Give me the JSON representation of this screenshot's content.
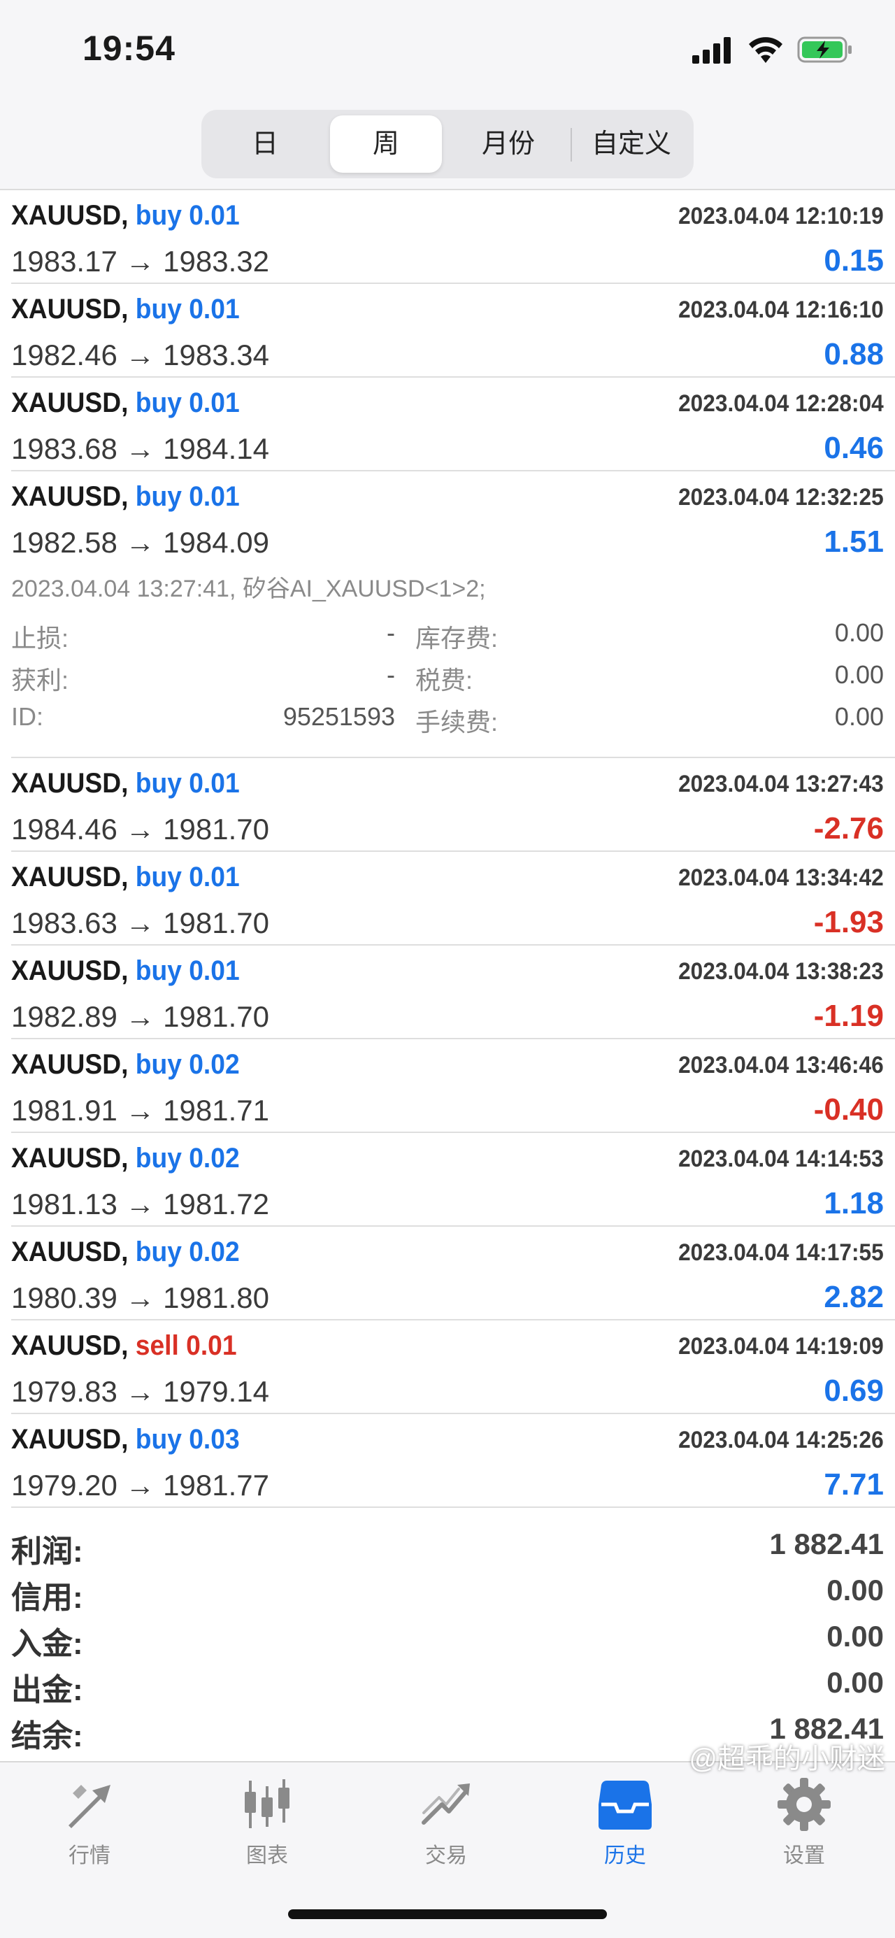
{
  "status_bar": {
    "time": "19:54"
  },
  "tabs": [
    {
      "label": "日",
      "active": false
    },
    {
      "label": "周",
      "active": true
    },
    {
      "label": "月份",
      "active": false
    },
    {
      "label": "自定义",
      "active": false
    }
  ],
  "trades_top": [
    {
      "symbol": "XAUUSD,",
      "side": "buy 0.01",
      "datetime": "2023.04.04 12:10:19",
      "prices": "1983.17 → 1983.32",
      "profit": "0.15"
    },
    {
      "symbol": "XAUUSD,",
      "side": "buy 0.01",
      "datetime": "2023.04.04 12:16:10",
      "prices": "1982.46 → 1983.34",
      "profit": "0.88"
    },
    {
      "symbol": "XAUUSD,",
      "side": "buy 0.01",
      "datetime": "2023.04.04 12:28:04",
      "prices": "1983.68 → 1984.14",
      "profit": "0.46"
    },
    {
      "symbol": "XAUUSD,",
      "side": "buy 0.01",
      "datetime": "2023.04.04 12:32:25",
      "prices": "1982.58 → 1984.09",
      "profit": "1.51"
    }
  ],
  "detail": {
    "comment": "2023.04.04 13:27:41, 矽谷AI_XAUUSD<1>2;",
    "stop_loss_label": "止损:",
    "stop_loss": "-",
    "take_profit_label": "获利:",
    "take_profit": "-",
    "id_label": "ID:",
    "id": "95251593",
    "swap_label": "库存费:",
    "swap": "0.00",
    "tax_label": "税费:",
    "tax": "0.00",
    "commission_label": "手续费:",
    "commission": "0.00"
  },
  "trades_bottom": [
    {
      "symbol": "XAUUSD,",
      "side": "buy 0.01",
      "datetime": "2023.04.04 13:27:43",
      "prices": "1984.46 → 1981.70",
      "profit": "-2.76"
    },
    {
      "symbol": "XAUUSD,",
      "side": "buy 0.01",
      "datetime": "2023.04.04 13:34:42",
      "prices": "1983.63 → 1981.70",
      "profit": "-1.93"
    },
    {
      "symbol": "XAUUSD,",
      "side": "buy 0.01",
      "datetime": "2023.04.04 13:38:23",
      "prices": "1982.89 → 1981.70",
      "profit": "-1.19"
    },
    {
      "symbol": "XAUUSD,",
      "side": "buy 0.02",
      "datetime": "2023.04.04 13:46:46",
      "prices": "1981.91 → 1981.71",
      "profit": "-0.40"
    },
    {
      "symbol": "XAUUSD,",
      "side": "buy 0.02",
      "datetime": "2023.04.04 14:14:53",
      "prices": "1981.13 → 1981.72",
      "profit": "1.18"
    },
    {
      "symbol": "XAUUSD,",
      "side": "buy 0.02",
      "datetime": "2023.04.04 14:17:55",
      "prices": "1980.39 → 1981.80",
      "profit": "2.82"
    },
    {
      "symbol": "XAUUSD,",
      "side": "sell 0.01",
      "datetime": "2023.04.04 14:19:09",
      "prices": "1979.83 → 1979.14",
      "profit": "0.69"
    },
    {
      "symbol": "XAUUSD,",
      "side": "buy 0.03",
      "datetime": "2023.04.04 14:25:26",
      "prices": "1979.20 → 1981.77",
      "profit": "7.71"
    }
  ],
  "summary": [
    {
      "label": "利润:",
      "value": "1 882.41"
    },
    {
      "label": "信用:",
      "value": "0.00"
    },
    {
      "label": "入金:",
      "value": "0.00"
    },
    {
      "label": "出金:",
      "value": "0.00"
    },
    {
      "label": "结余:",
      "value": "1 882.41"
    }
  ],
  "bottom_nav": [
    {
      "label": "行情",
      "icon": "quotes-arrows-icon",
      "active": false
    },
    {
      "label": "图表",
      "icon": "candlestick-chart-icon",
      "active": false
    },
    {
      "label": "交易",
      "icon": "trade-trend-icon",
      "active": false
    },
    {
      "label": "历史",
      "icon": "history-inbox-icon",
      "active": true
    },
    {
      "label": "设置",
      "icon": "gear-icon",
      "active": false
    }
  ],
  "watermark": "@超乖的小财迷",
  "colors": {
    "accent": "#1a73e8",
    "loss": "#d93025"
  }
}
